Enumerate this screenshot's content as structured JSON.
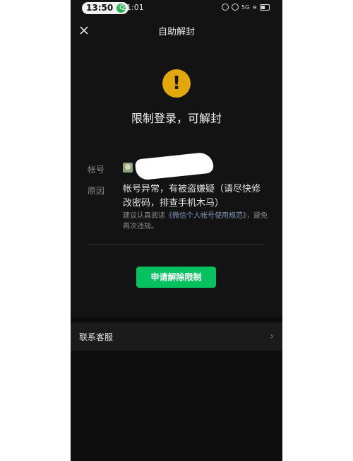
{
  "status_bar": {
    "time_pill": "13:50",
    "clock": "21:01",
    "signal": "5G"
  },
  "nav": {
    "title": "自助解封"
  },
  "main": {
    "warning_glyph": "!",
    "headline": "限制登录，可解封",
    "account_label": "帐号",
    "reason_label": "原因",
    "reason_text": "帐号异常，有被盗嫌疑（请尽快修改密码，排查手机木马）",
    "hint_prefix": "建议认真阅读",
    "hint_link": "《微信个人帐号使用规范》",
    "hint_suffix": "，避免再次违规。",
    "apply_button": "申请解除限制"
  },
  "contact": {
    "label": "联系客服",
    "chevron": "›"
  },
  "colors": {
    "accent_green": "#07c160",
    "warning_yellow": "#e2a70d",
    "background": "#131313",
    "link_blue": "#7d94b8"
  }
}
